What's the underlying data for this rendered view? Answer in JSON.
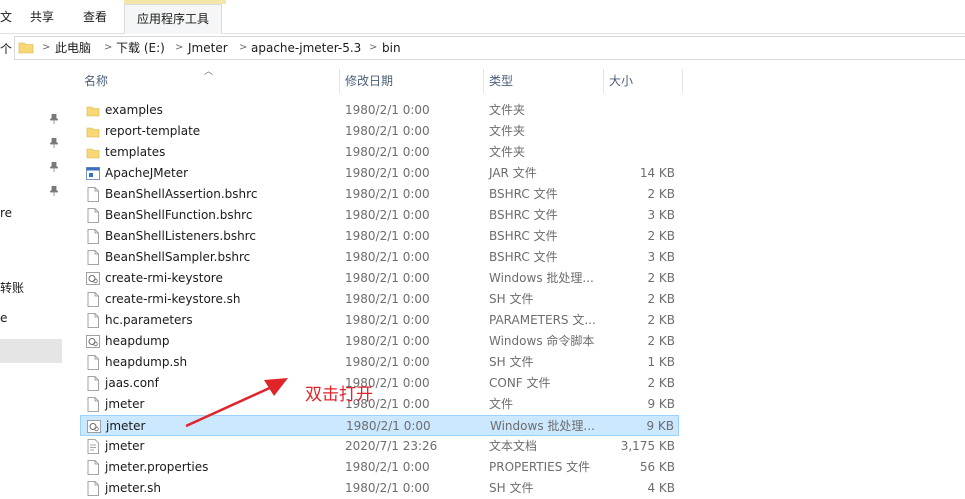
{
  "ribbon": {
    "tabs": [
      {
        "label": "文"
      },
      {
        "label": "共享"
      },
      {
        "label": "查看"
      }
    ],
    "context_tab": {
      "label": "应用程序工具"
    }
  },
  "address": {
    "segments": [
      "此电脑",
      "下载 (E:)",
      "Jmeter",
      "apache-jmeter-5.3",
      "bin"
    ]
  },
  "nav": {
    "items": [
      {
        "label": "re"
      },
      {
        "label": "转账"
      },
      {
        "label": "e"
      }
    ]
  },
  "columns": {
    "name": "名称",
    "date": "修改日期",
    "type": "类型",
    "size": "大小"
  },
  "files": [
    {
      "name": "examples",
      "date": "1980/2/1 0:00",
      "type": "文件夹",
      "size": "",
      "icon": "folder-icon"
    },
    {
      "name": "report-template",
      "date": "1980/2/1 0:00",
      "type": "文件夹",
      "size": "",
      "icon": "folder-icon"
    },
    {
      "name": "templates",
      "date": "1980/2/1 0:00",
      "type": "文件夹",
      "size": "",
      "icon": "folder-icon"
    },
    {
      "name": "ApacheJMeter",
      "date": "1980/2/1 0:00",
      "type": "JAR 文件",
      "size": "14 KB",
      "icon": "jar-icon"
    },
    {
      "name": "BeanShellAssertion.bshrc",
      "date": "1980/2/1 0:00",
      "type": "BSHRC 文件",
      "size": "2 KB",
      "icon": "file-icon"
    },
    {
      "name": "BeanShellFunction.bshrc",
      "date": "1980/2/1 0:00",
      "type": "BSHRC 文件",
      "size": "3 KB",
      "icon": "file-icon"
    },
    {
      "name": "BeanShellListeners.bshrc",
      "date": "1980/2/1 0:00",
      "type": "BSHRC 文件",
      "size": "2 KB",
      "icon": "file-icon"
    },
    {
      "name": "BeanShellSampler.bshrc",
      "date": "1980/2/1 0:00",
      "type": "BSHRC 文件",
      "size": "3 KB",
      "icon": "file-icon"
    },
    {
      "name": "create-rmi-keystore",
      "date": "1980/2/1 0:00",
      "type": "Windows 批处理...",
      "size": "2 KB",
      "icon": "batch-icon"
    },
    {
      "name": "create-rmi-keystore.sh",
      "date": "1980/2/1 0:00",
      "type": "SH 文件",
      "size": "2 KB",
      "icon": "file-icon"
    },
    {
      "name": "hc.parameters",
      "date": "1980/2/1 0:00",
      "type": "PARAMETERS 文...",
      "size": "2 KB",
      "icon": "file-icon"
    },
    {
      "name": "heapdump",
      "date": "1980/2/1 0:00",
      "type": "Windows 命令脚本",
      "size": "2 KB",
      "icon": "batch-icon"
    },
    {
      "name": "heapdump.sh",
      "date": "1980/2/1 0:00",
      "type": "SH 文件",
      "size": "1 KB",
      "icon": "file-icon"
    },
    {
      "name": "jaas.conf",
      "date": "1980/2/1 0:00",
      "type": "CONF 文件",
      "size": "2 KB",
      "icon": "file-icon"
    },
    {
      "name": "jmeter",
      "date": "1980/2/1 0:00",
      "type": "文件",
      "size": "9 KB",
      "icon": "file-icon"
    },
    {
      "name": "jmeter",
      "date": "1980/2/1 0:00",
      "type": "Windows 批处理...",
      "size": "9 KB",
      "icon": "batch-icon",
      "selected": true
    },
    {
      "name": "jmeter",
      "date": "2020/7/1 23:26",
      "type": "文本文档",
      "size": "3,175 KB",
      "icon": "text-icon"
    },
    {
      "name": "jmeter.properties",
      "date": "1980/2/1 0:00",
      "type": "PROPERTIES 文件",
      "size": "56 KB",
      "icon": "file-icon"
    },
    {
      "name": "jmeter.sh",
      "date": "1980/2/1 0:00",
      "type": "SH 文件",
      "size": "4 KB",
      "icon": "file-icon"
    }
  ],
  "annotation": {
    "text": "双击打开",
    "color": "#e0242a"
  },
  "colors": {
    "selection": "#cce8ff",
    "selection_border": "#99d1ff",
    "folder": "#f8d775",
    "header_text": "#4c607a"
  }
}
